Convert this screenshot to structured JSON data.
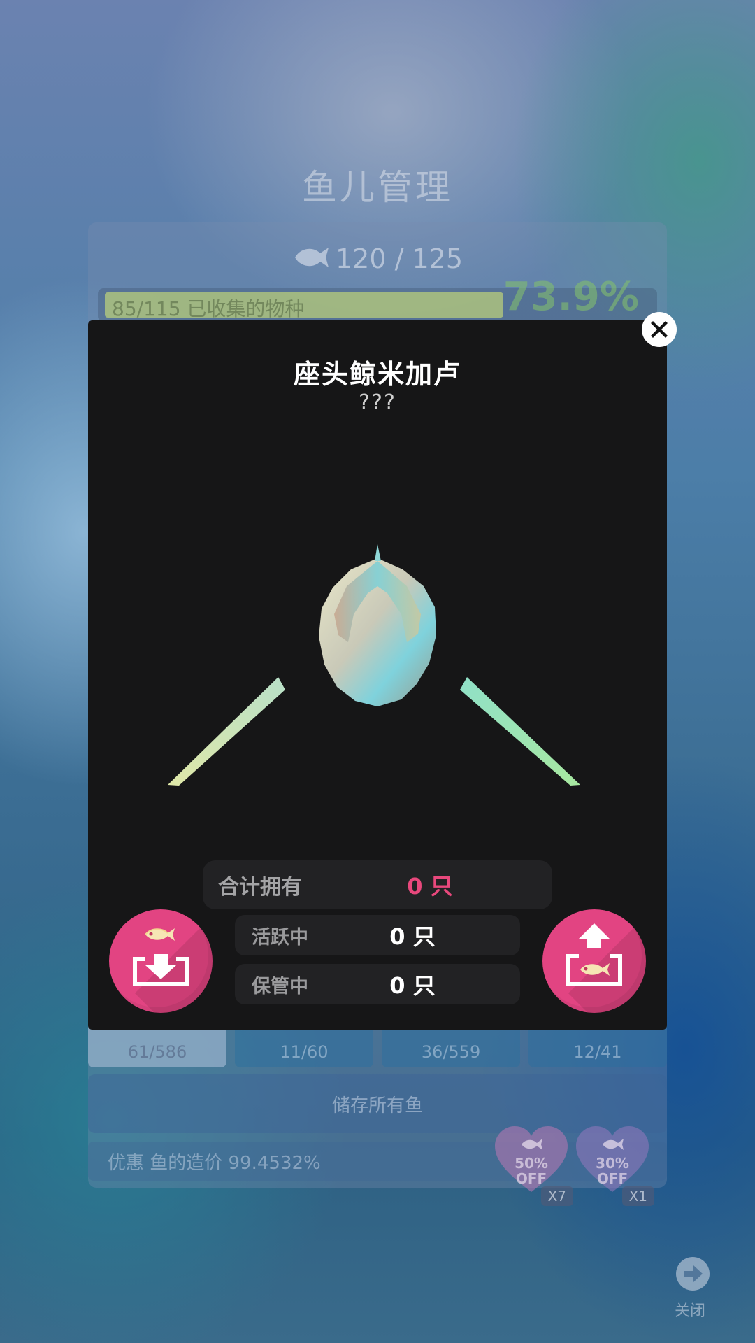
{
  "background": {
    "title": "鱼儿管理",
    "fish_count": "120 / 125",
    "progress": {
      "label": "85/115 已收集的物种",
      "percent_text": "73.9%",
      "fraction": 0.739
    },
    "tabs": [
      {
        "value": "61/586",
        "active": true
      },
      {
        "value": "11/60",
        "active": false
      },
      {
        "value": "36/559",
        "active": false
      },
      {
        "value": "12/41",
        "active": false
      }
    ],
    "store_all_button": "储存所有鱼",
    "discount_text": "优惠 鱼的造价 99.4532%",
    "coupons": [
      {
        "percent": "50%",
        "off": "OFF",
        "count": "X7"
      },
      {
        "percent": "30%",
        "off": "OFF",
        "count": "X1"
      }
    ],
    "close_label": "关闭"
  },
  "modal": {
    "title": "座头鲸米加卢",
    "subtitle": "???",
    "stats": {
      "total_label": "合计拥有",
      "total_value": "0 只",
      "active_label": "活跃中",
      "active_value": "0 只",
      "stored_label": "保管中",
      "stored_value": "0 只"
    }
  },
  "colors": {
    "accent_pink": "#e24482",
    "modal_bg": "#161617",
    "total_value_color": "#e8487c"
  },
  "icons": {
    "close": "close-icon",
    "store": "store-fish-icon",
    "release": "release-fish-icon"
  }
}
